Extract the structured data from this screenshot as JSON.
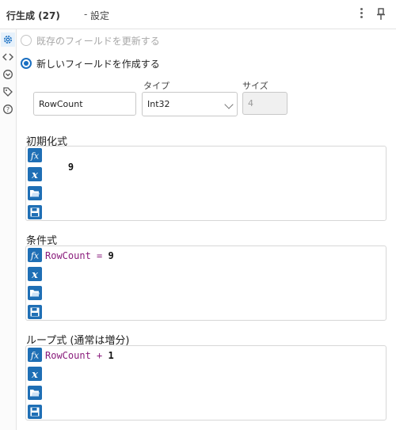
{
  "header": {
    "title": "行生成 (27)",
    "separator": "-",
    "subtitle": "設定"
  },
  "options": {
    "update_existing": "既存のフィールドを更新する",
    "create_new": "新しいフィールドを作成する"
  },
  "new_field": {
    "name_value": "RowCount",
    "type_label": "タイプ",
    "type_value": "Int32",
    "size_label": "サイズ",
    "size_value": "4"
  },
  "init_expr": {
    "label": "初期化式",
    "code": "9"
  },
  "cond_expr": {
    "label": "条件式",
    "field": "RowCount",
    "op": "=",
    "value": "9"
  },
  "loop_expr": {
    "label": "ループ式 (通常は増分)",
    "field": "RowCount",
    "op": "+",
    "value": "1"
  },
  "icons": [
    "gear-icon",
    "code-icon",
    "connection-icon",
    "tag-icon",
    "help-icon",
    "kebab-menu-icon",
    "pin-icon",
    "fx-icon",
    "variable-icon",
    "open-folder-icon",
    "save-icon"
  ],
  "colors": {
    "accent": "#1a6fc1",
    "tool_button": "#1f6fb5",
    "code_field": "#8a1c7c"
  }
}
